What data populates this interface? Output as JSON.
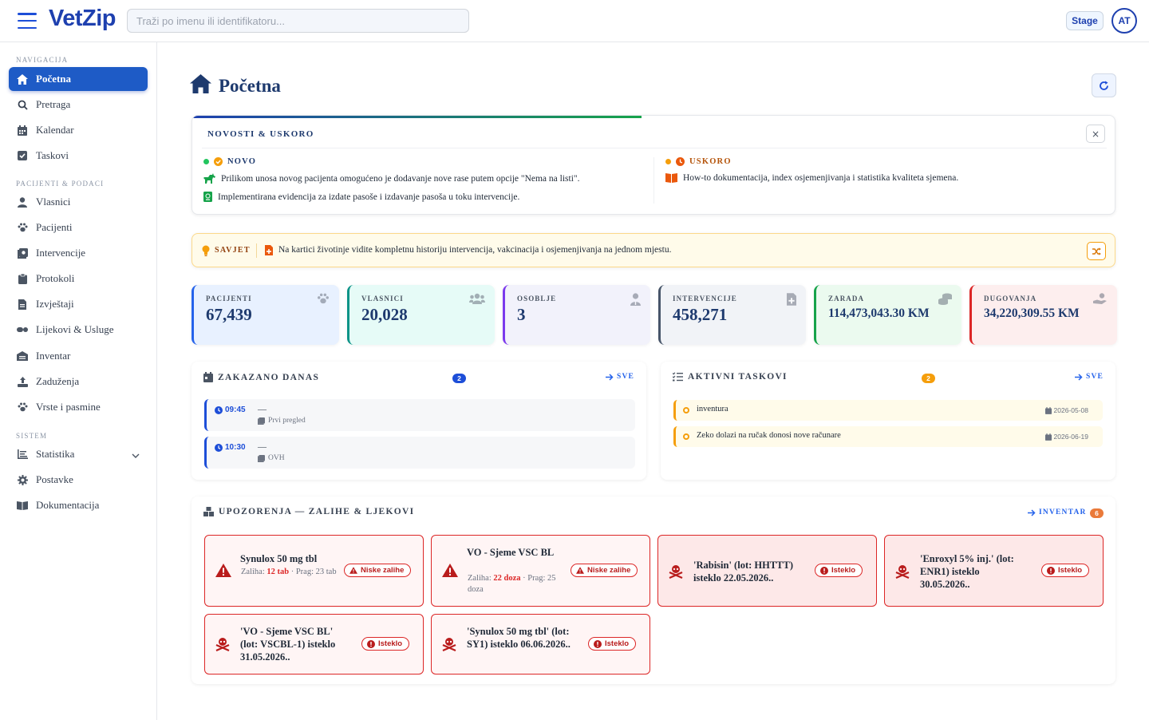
{
  "app": {
    "name": "VetZip",
    "env_label": "Stage",
    "user_initials": "AT"
  },
  "search": {
    "placeholder": "Traži po imenu ili identifikatoru..."
  },
  "sidebar": {
    "sections": [
      {
        "title": "NAVIGACIJA"
      },
      {
        "title": "PACIJENTI & PODACI"
      },
      {
        "title": "SISTEM"
      }
    ],
    "items": [
      {
        "label": "Početna",
        "icon": "home-icon",
        "active": true
      },
      {
        "label": "Pretraga",
        "icon": "search-icon"
      },
      {
        "label": "Kalendar",
        "icon": "calendar-icon"
      },
      {
        "label": "Taskovi",
        "icon": "checkbox-icon"
      },
      {
        "label": "Vlasnici",
        "icon": "user-icon"
      },
      {
        "label": "Pacijenti",
        "icon": "paw-icon"
      },
      {
        "label": "Intervencije",
        "icon": "notes-medical-icon"
      },
      {
        "label": "Protokoli",
        "icon": "clipboard-icon"
      },
      {
        "label": "Izvještaji",
        "icon": "file-icon"
      },
      {
        "label": "Lijekovi & Usluge",
        "icon": "pills-icon"
      },
      {
        "label": "Inventar",
        "icon": "warehouse-icon"
      },
      {
        "label": "Zaduženja",
        "icon": "upload-icon"
      },
      {
        "label": "Vrste i pasmine",
        "icon": "paw-icon"
      },
      {
        "label": "Statistika",
        "icon": "chart-icon"
      },
      {
        "label": "Postavke",
        "icon": "gear-icon"
      },
      {
        "label": "Dokumentacija",
        "icon": "book-icon"
      }
    ]
  },
  "page": {
    "title": "Početna"
  },
  "news": {
    "title": "NOVOSTI & USKORO",
    "new_label": "NOVO",
    "new_items": [
      "Prilikom unosa novog pacijenta omogućeno je dodavanje nove rase putem opcije \"Nema na listi\".",
      "Implementirana evidencija za izdate pasoše i izdavanje pasoša u toku intervencije."
    ],
    "soon_label": "USKORO",
    "soon_items": [
      "How-to dokumentacija, index osjemenjivanja i statistika kvaliteta sjemena."
    ],
    "close": "×"
  },
  "tip": {
    "label": "SAVJET",
    "text": "Na kartici životinje vidite kompletnu historiju intervencija, vakcinacija i osjemenjivanja na jednom mjestu."
  },
  "stats": [
    {
      "label": "PACIJENTI",
      "value": "67,439",
      "icon": "paw-icon",
      "color": "#2563eb",
      "bg": "#e8f1ff"
    },
    {
      "label": "VLASNICI",
      "value": "20,028",
      "icon": "users-icon",
      "color": "#0d9488",
      "bg": "#e6fbf7"
    },
    {
      "label": "OSOBLJE",
      "value": "3",
      "icon": "user-doctor-icon",
      "color": "#7c3aed",
      "bg": "#f2f2fb"
    },
    {
      "label": "INTERVENCIJE",
      "value": "458,271",
      "icon": "file-medical-icon",
      "color": "#475569",
      "bg": "#f1f3f7"
    },
    {
      "label": "ZARADA",
      "value": "114,473,043.30 KM",
      "icon": "coins-icon",
      "color": "#16a34a",
      "bg": "#ebfaef"
    },
    {
      "label": "DUGOVANJA",
      "value": "34,220,309.55 KM",
      "icon": "hand-coin-icon",
      "color": "#dc2626",
      "bg": "#fdeeee"
    }
  ],
  "scheduled": {
    "title": "ZAKAZANO DANAS",
    "count": "2",
    "link": "SVE",
    "items": [
      {
        "time": "09:45",
        "who": "—",
        "what": "Prvi pregled"
      },
      {
        "time": "10:30",
        "who": "—",
        "what": "OVH"
      }
    ]
  },
  "tasks": {
    "title": "AKTIVNI TASKOVI",
    "count": "2",
    "link": "SVE",
    "items": [
      {
        "text": "inventura",
        "date": "2026-05-08"
      },
      {
        "text": "Zeko dolazi na ručak donosi nove računare",
        "date": "2026-06-19"
      }
    ]
  },
  "warnings": {
    "title": "UPOZORENJA — ZALIHE & LJEKOVI",
    "link": "INVENTAR",
    "count": "6",
    "items": [
      {
        "title": "Synulox 50 mg tbl",
        "stock_label": "Zaliha:",
        "stock": "12 tab",
        "threshold": "· Prag: 23 tab",
        "status": "Niske zalihe",
        "type": "low"
      },
      {
        "title": "VO - Sjeme VSC BL",
        "stock_label": "Zaliha:",
        "stock": "22 doza",
        "threshold": "· Prag: 25 doza",
        "status": "Niske zalihe",
        "type": "low"
      },
      {
        "title": "'Rabisin' (lot: HHTTT) isteklo 22.05.2026..",
        "status": "Isteklo",
        "type": "expired"
      },
      {
        "title": "'Enroxyl 5% inj.' (lot: ENR1) isteklo 30.05.2026..",
        "status": "Isteklo",
        "type": "expired"
      },
      {
        "title": "'VO - Sjeme VSC BL' (lot: VSCBL-1) isteklo 31.05.2026..",
        "status": "Isteklo",
        "type": "expired"
      },
      {
        "title": "'Synulox 50 mg tbl' (lot: SY1) isteklo 06.06.2026..",
        "status": "Isteklo",
        "type": "expired"
      }
    ]
  }
}
